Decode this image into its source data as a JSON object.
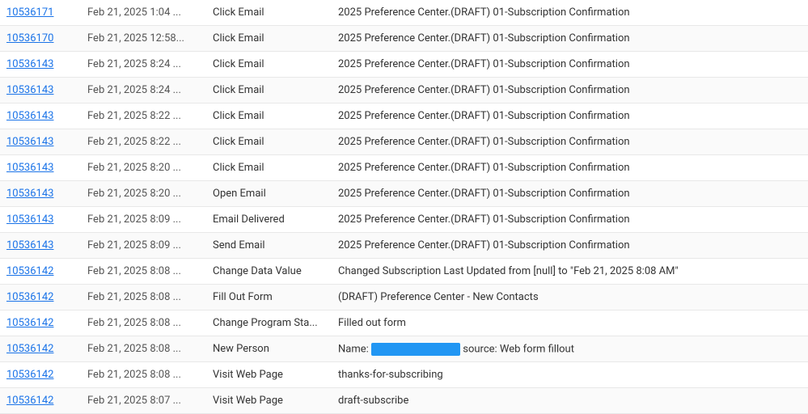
{
  "rows": [
    {
      "id": "10536171",
      "date": "Feb 21, 2025 1:04 ...",
      "action": "Click Email",
      "detail": "2025 Preference Center.(DRAFT) 01-Subscription Confirmation"
    },
    {
      "id": "10536170",
      "date": "Feb 21, 2025 12:58...",
      "action": "Click Email",
      "detail": "2025 Preference Center.(DRAFT) 01-Subscription Confirmation"
    },
    {
      "id": "10536143",
      "date": "Feb 21, 2025 8:24 ...",
      "action": "Click Email",
      "detail": "2025 Preference Center.(DRAFT) 01-Subscription Confirmation"
    },
    {
      "id": "10536143",
      "date": "Feb 21, 2025 8:24 ...",
      "action": "Click Email",
      "detail": "2025 Preference Center.(DRAFT) 01-Subscription Confirmation"
    },
    {
      "id": "10536143",
      "date": "Feb 21, 2025 8:22 ...",
      "action": "Click Email",
      "detail": "2025 Preference Center.(DRAFT) 01-Subscription Confirmation"
    },
    {
      "id": "10536143",
      "date": "Feb 21, 2025 8:22 ...",
      "action": "Click Email",
      "detail": "2025 Preference Center.(DRAFT) 01-Subscription Confirmation"
    },
    {
      "id": "10536143",
      "date": "Feb 21, 2025 8:20 ...",
      "action": "Click Email",
      "detail": "2025 Preference Center.(DRAFT) 01-Subscription Confirmation"
    },
    {
      "id": "10536143",
      "date": "Feb 21, 2025 8:20 ...",
      "action": "Open Email",
      "detail": "2025 Preference Center.(DRAFT) 01-Subscription Confirmation"
    },
    {
      "id": "10536143",
      "date": "Feb 21, 2025 8:09 ...",
      "action": "Email Delivered",
      "detail": "2025 Preference Center.(DRAFT) 01-Subscription Confirmation"
    },
    {
      "id": "10536143",
      "date": "Feb 21, 2025 8:09 ...",
      "action": "Send Email",
      "detail": "2025 Preference Center.(DRAFT) 01-Subscription Confirmation"
    },
    {
      "id": "10536142",
      "date": "Feb 21, 2025 8:08 ...",
      "action": "Change Data Value",
      "detail": "Changed Subscription Last Updated from [null] to \"Feb 21, 2025 8:08 AM\"",
      "type": "change"
    },
    {
      "id": "10536142",
      "date": "Feb 21, 2025 8:08 ...",
      "action": "Fill Out Form",
      "detail": "(DRAFT) Preference Center - New Contacts"
    },
    {
      "id": "10536142",
      "date": "Feb 21, 2025 8:08 ...",
      "action": "Change Program Sta...",
      "detail": "Filled out form"
    },
    {
      "id": "10536142",
      "date": "Feb 21, 2025 8:08 ...",
      "action": "New Person",
      "detail_prefix": "Name:",
      "detail_name": "",
      "detail_suffix": "source: Web form fillout",
      "type": "new_person"
    },
    {
      "id": "10536142",
      "date": "Feb 21, 2025 8:08 ...",
      "action": "Visit Web Page",
      "detail": "thanks-for-subscribing"
    },
    {
      "id": "10536142",
      "date": "Feb 21, 2025 8:07 ...",
      "action": "Visit Web Page",
      "detail": "draft-subscribe"
    }
  ]
}
